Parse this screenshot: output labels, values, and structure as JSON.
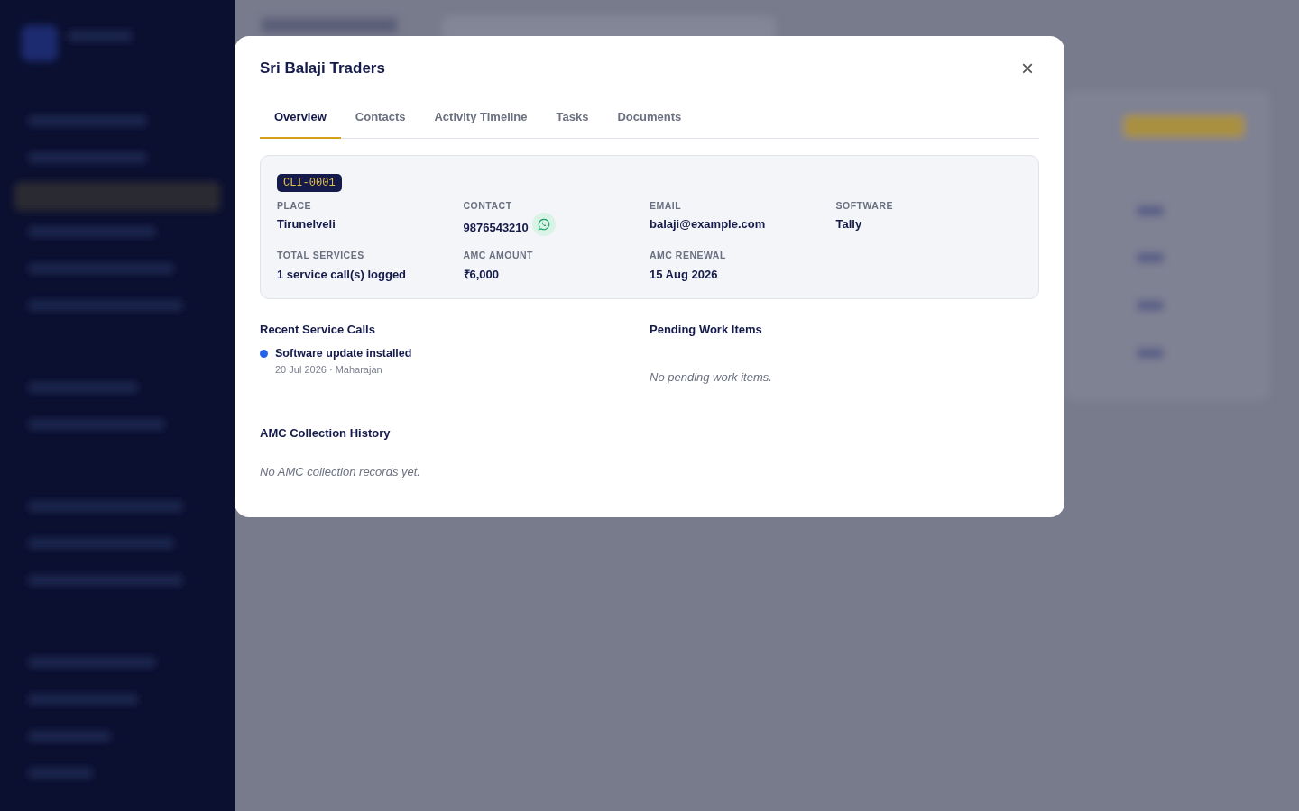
{
  "modal": {
    "title": "Sri Balaji Traders",
    "close": "×"
  },
  "tabs": [
    {
      "label": "Overview",
      "selected": true
    },
    {
      "label": "Contacts",
      "selected": false
    },
    {
      "label": "Activity Timeline",
      "selected": false
    },
    {
      "label": "Tasks",
      "selected": false
    },
    {
      "label": "Documents",
      "selected": false
    }
  ],
  "client": {
    "code": "CLI-0001",
    "fields": [
      {
        "label": "PLACE",
        "value": "Tirunelveli"
      },
      {
        "label": "CONTACT",
        "value": "9876543210",
        "kind": "phone"
      },
      {
        "label": "EMAIL",
        "value": "balaji@example.com"
      },
      {
        "label": "SOFTWARE",
        "value": "Tally"
      },
      {
        "label": "TOTAL SERVICES",
        "value": "1 service call(s) logged"
      },
      {
        "label": "AMC AMOUNT",
        "value": "₹6,000"
      },
      {
        "label": "AMC RENEWAL",
        "value": "15 Aug 2026"
      }
    ]
  },
  "recent_service_calls": {
    "title": "Recent Service Calls",
    "items": [
      {
        "title": "Software update installed",
        "meta": "20 Jul 2026 · Maharajan",
        "color": "#2563eb"
      }
    ]
  },
  "pending_work_items": {
    "title": "Pending Work Items",
    "empty": "No pending work items."
  },
  "amc_collection_history": {
    "title": "AMC Collection History",
    "empty": "No AMC collection records yet."
  }
}
